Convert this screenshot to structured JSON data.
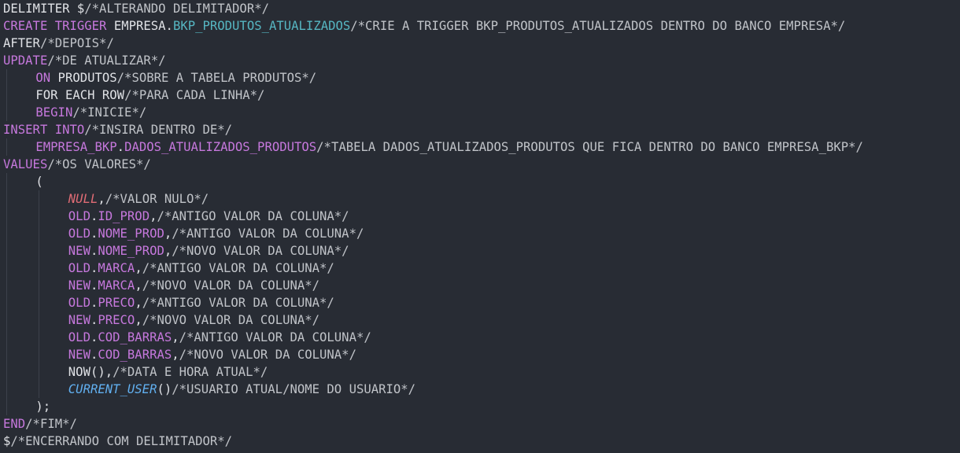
{
  "colors": {
    "background": "#282c34",
    "text": "#e0e2e6",
    "keyword": "#c678dd",
    "object": "#56b6c2",
    "comment": "#c0c3c8",
    "null_literal": "#e06c75",
    "function": "#61afef"
  },
  "code_lines": [
    {
      "tokens": [
        {
          "text": "DELIMITER $",
          "kind": "default"
        },
        {
          "text": "/*ALTERANDO DELIMITADOR*/",
          "kind": "comment"
        }
      ]
    },
    {
      "tokens": [
        {
          "text": "CREATE TRIGGER",
          "kind": "keyword"
        },
        {
          "text": " EMPRESA",
          "kind": "default"
        },
        {
          "text": ".",
          "kind": "default"
        },
        {
          "text": "BKP_PRODUTOS_ATUALIZADOS",
          "kind": "object"
        },
        {
          "text": "/*CRIE A TRIGGER BKP_PRODUTOS_ATUALIZADOS DENTRO DO BANCO EMPRESA*/",
          "kind": "comment"
        }
      ]
    },
    {
      "tokens": [
        {
          "text": "AFTER",
          "kind": "default"
        },
        {
          "text": "/*DEPOIS*/",
          "kind": "comment"
        }
      ]
    },
    {
      "tokens": [
        {
          "text": "UPDATE",
          "kind": "keyword"
        },
        {
          "text": "/*DE ATUALIZAR*/",
          "kind": "comment"
        }
      ]
    },
    {
      "indent": 1,
      "tokens": [
        {
          "text": "ON",
          "kind": "keyword"
        },
        {
          "text": " PRODUTOS",
          "kind": "default"
        },
        {
          "text": "/*SOBRE A TABELA PRODUTOS*/",
          "kind": "comment"
        }
      ]
    },
    {
      "indent": 1,
      "tokens": [
        {
          "text": "FOR EACH ROW",
          "kind": "default"
        },
        {
          "text": "/*PARA CADA LINHA*/",
          "kind": "comment"
        }
      ]
    },
    {
      "indent": 1,
      "tokens": [
        {
          "text": "BEGIN",
          "kind": "keyword"
        },
        {
          "text": "/*INICIE*/",
          "kind": "comment"
        }
      ]
    },
    {
      "tokens": [
        {
          "text": "INSERT INTO",
          "kind": "keyword"
        },
        {
          "text": "/*INSIRA DENTRO DE*/",
          "kind": "comment"
        }
      ]
    },
    {
      "indent": 1,
      "tokens": [
        {
          "text": "EMPRESA_BKP",
          "kind": "keyword"
        },
        {
          "text": ".",
          "kind": "default"
        },
        {
          "text": "DADOS_ATUALIZADOS_PRODUTOS",
          "kind": "keyword"
        },
        {
          "text": "/*TABELA DADOS_ATUALIZADOS_PRODUTOS QUE FICA DENTRO DO BANCO EMPRESA_BKP*/",
          "kind": "comment"
        }
      ]
    },
    {
      "tokens": [
        {
          "text": "VALUES",
          "kind": "keyword"
        },
        {
          "text": "/*OS VALORES*/",
          "kind": "comment"
        }
      ]
    },
    {
      "indent": 1,
      "tokens": [
        {
          "text": "(",
          "kind": "default"
        }
      ]
    },
    {
      "indent": 2,
      "tokens": [
        {
          "text": "NULL",
          "kind": "null"
        },
        {
          "text": ",",
          "kind": "default"
        },
        {
          "text": "/*VALOR NULO*/",
          "kind": "comment"
        }
      ]
    },
    {
      "indent": 2,
      "tokens": [
        {
          "text": "OLD",
          "kind": "keyword"
        },
        {
          "text": ".",
          "kind": "default"
        },
        {
          "text": "ID_PROD",
          "kind": "keyword"
        },
        {
          "text": ",",
          "kind": "default"
        },
        {
          "text": "/*ANTIGO VALOR DA COLUNA*/",
          "kind": "comment"
        }
      ]
    },
    {
      "indent": 2,
      "tokens": [
        {
          "text": "OLD",
          "kind": "keyword"
        },
        {
          "text": ".",
          "kind": "default"
        },
        {
          "text": "NOME_PROD",
          "kind": "keyword"
        },
        {
          "text": ",",
          "kind": "default"
        },
        {
          "text": "/*ANTIGO VALOR DA COLUNA*/",
          "kind": "comment"
        }
      ]
    },
    {
      "indent": 2,
      "tokens": [
        {
          "text": "NEW",
          "kind": "keyword"
        },
        {
          "text": ".",
          "kind": "default"
        },
        {
          "text": "NOME_PROD",
          "kind": "keyword"
        },
        {
          "text": ",",
          "kind": "default"
        },
        {
          "text": "/*NOVO VALOR DA COLUNA*/",
          "kind": "comment"
        }
      ]
    },
    {
      "indent": 2,
      "tokens": [
        {
          "text": "OLD",
          "kind": "keyword"
        },
        {
          "text": ".",
          "kind": "default"
        },
        {
          "text": "MARCA",
          "kind": "keyword"
        },
        {
          "text": ",",
          "kind": "default"
        },
        {
          "text": "/*ANTIGO VALOR DA COLUNA*/",
          "kind": "comment"
        }
      ]
    },
    {
      "indent": 2,
      "tokens": [
        {
          "text": "NEW",
          "kind": "keyword"
        },
        {
          "text": ".",
          "kind": "default"
        },
        {
          "text": "MARCA",
          "kind": "keyword"
        },
        {
          "text": ",",
          "kind": "default"
        },
        {
          "text": "/*NOVO VALOR DA COLUNA*/",
          "kind": "comment"
        }
      ]
    },
    {
      "indent": 2,
      "tokens": [
        {
          "text": "OLD",
          "kind": "keyword"
        },
        {
          "text": ".",
          "kind": "default"
        },
        {
          "text": "PRECO",
          "kind": "keyword"
        },
        {
          "text": ",",
          "kind": "default"
        },
        {
          "text": "/*ANTIGO VALOR DA COLUNA*/",
          "kind": "comment"
        }
      ]
    },
    {
      "indent": 2,
      "tokens": [
        {
          "text": "NEW",
          "kind": "keyword"
        },
        {
          "text": ".",
          "kind": "default"
        },
        {
          "text": "PRECO",
          "kind": "keyword"
        },
        {
          "text": ",",
          "kind": "default"
        },
        {
          "text": "/*NOVO VALOR DA COLUNA*/",
          "kind": "comment"
        }
      ]
    },
    {
      "indent": 2,
      "tokens": [
        {
          "text": "OLD",
          "kind": "keyword"
        },
        {
          "text": ".",
          "kind": "default"
        },
        {
          "text": "COD_BARRAS",
          "kind": "keyword"
        },
        {
          "text": ",",
          "kind": "default"
        },
        {
          "text": "/*ANTIGO VALOR DA COLUNA*/",
          "kind": "comment"
        }
      ]
    },
    {
      "indent": 2,
      "tokens": [
        {
          "text": "NEW",
          "kind": "keyword"
        },
        {
          "text": ".",
          "kind": "default"
        },
        {
          "text": "COD_BARRAS",
          "kind": "keyword"
        },
        {
          "text": ",",
          "kind": "default"
        },
        {
          "text": "/*NOVO VALOR DA COLUNA*/",
          "kind": "comment"
        }
      ]
    },
    {
      "indent": 2,
      "tokens": [
        {
          "text": "NOW(),",
          "kind": "default"
        },
        {
          "text": "/*DATA E HORA ATUAL*/",
          "kind": "comment"
        }
      ]
    },
    {
      "indent": 2,
      "tokens": [
        {
          "text": "CURRENT_USER",
          "kind": "func"
        },
        {
          "text": "()",
          "kind": "default"
        },
        {
          "text": "/*USUARIO ATUAL/NOME DO USUARIO*/",
          "kind": "comment"
        }
      ]
    },
    {
      "indent": 1,
      "tokens": [
        {
          "text": ");",
          "kind": "default"
        }
      ]
    },
    {
      "tokens": [
        {
          "text": "END",
          "kind": "keyword"
        },
        {
          "text": "/*FIM*/",
          "kind": "comment"
        }
      ]
    },
    {
      "tokens": [
        {
          "text": "$",
          "kind": "default"
        },
        {
          "text": "/*ENCERRANDO COM DELIMITADOR*/",
          "kind": "comment"
        }
      ]
    }
  ]
}
